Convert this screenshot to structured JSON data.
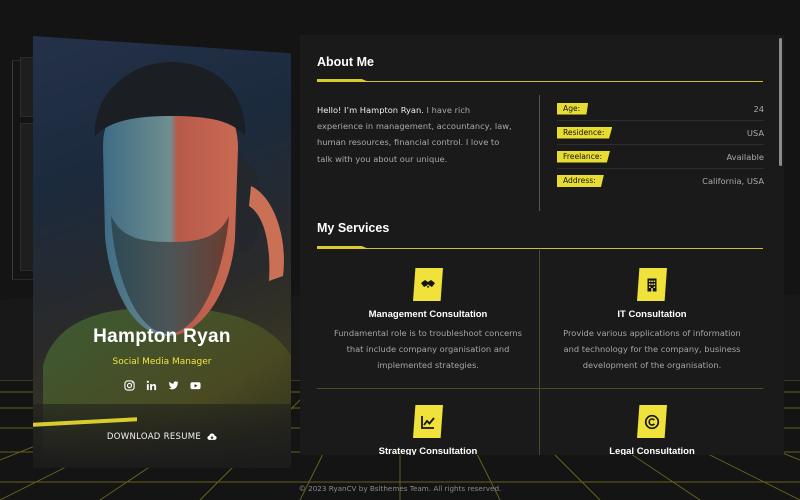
{
  "sidebar": {
    "top_items": [
      {
        "icon": "menu-icon"
      },
      {
        "icon": "theme-toggle-icon"
      }
    ],
    "items": [
      {
        "icon": "user-icon",
        "active": true
      },
      {
        "icon": "resume-icon"
      },
      {
        "icon": "folder-icon"
      },
      {
        "icon": "blog-icon"
      },
      {
        "icon": "send-icon"
      }
    ]
  },
  "profile": {
    "name": "Hampton Ryan",
    "role": "Social Media Manager",
    "socials": [
      "instagram-icon",
      "linkedin-icon",
      "twitter-icon",
      "youtube-icon"
    ],
    "download_label": "DOWNLOAD RESUME"
  },
  "about": {
    "title": "About Me",
    "lead": "Hello! I’m Hampton Ryan.",
    "text": " I have rich experience in management, accountancy, law, human resources, financial control. I love to talk with you about our unique.",
    "info": [
      {
        "label": "Age:",
        "value": "24"
      },
      {
        "label": "Residence:",
        "value": "USA"
      },
      {
        "label": "Freelance:",
        "value": "Available"
      },
      {
        "label": "Address:",
        "value": "California, USA"
      }
    ]
  },
  "services": {
    "title": "My Services",
    "items": [
      {
        "icon": "handshake-icon",
        "title": "Management Consultation",
        "desc": "Fundamental role is to troubleshoot concerns that include company organisation and implemented strategies."
      },
      {
        "icon": "building-icon",
        "title": "IT Consultation",
        "desc": "Provide various applications of information and technology for the company, business development of the organisation."
      },
      {
        "icon": "chart-icon",
        "title": "Strategy Consultation",
        "desc": ""
      },
      {
        "icon": "copyright-icon",
        "title": "Legal Consultation",
        "desc": ""
      }
    ]
  },
  "footer": {
    "text": "© 2023 RyanCV by Bslthemes Team. All rights reserved."
  },
  "colors": {
    "accent": "#e8dc33",
    "background": "#141414",
    "panel": "#1a1a1a"
  }
}
